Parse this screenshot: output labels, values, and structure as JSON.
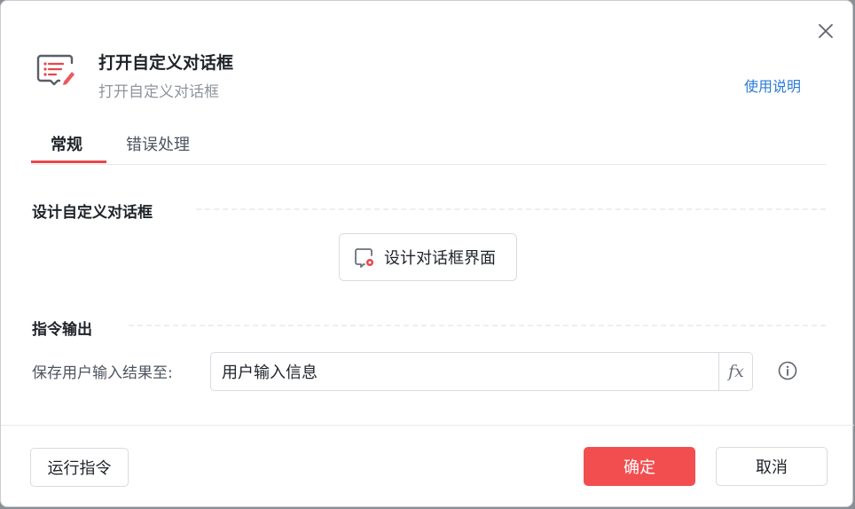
{
  "dialog": {
    "title": "打开自定义对话框",
    "subtitle": "打开自定义对话框",
    "help_link": "使用说明",
    "close_icon": "close-icon",
    "header_icon": "dialog-edit-icon"
  },
  "tabs": [
    {
      "label": "常规",
      "active": true
    },
    {
      "label": "错误处理",
      "active": false
    }
  ],
  "sections": {
    "design": {
      "title": "设计自定义对话框",
      "button_label": "设计对话框界面",
      "button_icon": "dialog-design-icon"
    },
    "output": {
      "title": "指令输出",
      "field_label": "保存用户输入结果至:",
      "field_value": "用户输入信息",
      "fx_label": "fx",
      "info_icon": "info-icon"
    }
  },
  "footer": {
    "run_label": "运行指令",
    "ok_label": "确定",
    "cancel_label": "取消"
  },
  "colors": {
    "accent": "#f24e50",
    "link": "#2a7bd8",
    "tab_underline": "#e8474c"
  }
}
